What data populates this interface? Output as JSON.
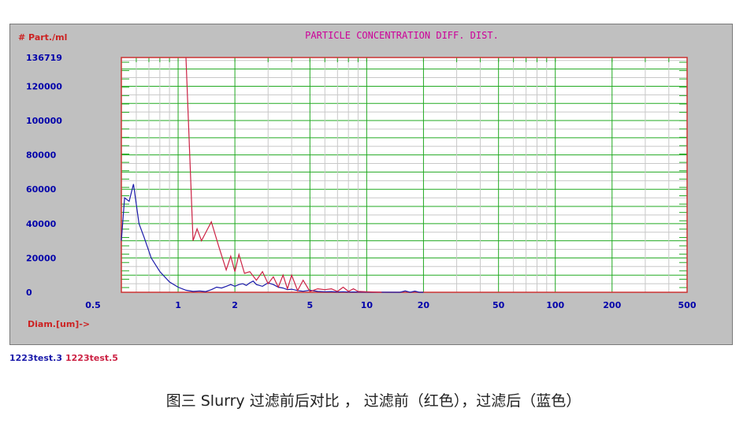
{
  "chart_data": {
    "type": "line",
    "title": "PARTICLE CONCENTRATION DIFF. DIST.",
    "ylabel": "# Part./ml",
    "xlabel": "Diam.[um]->",
    "x_scale": "log",
    "xlim": [
      0.5,
      500
    ],
    "ylim": [
      0,
      136719
    ],
    "y_ticks": [
      "0",
      "20000",
      "40000",
      "60000",
      "80000",
      "100000",
      "120000",
      "136719"
    ],
    "y_tick_values": [
      0,
      20000,
      40000,
      60000,
      80000,
      100000,
      120000,
      136719
    ],
    "x_ticks": [
      "0.5",
      "1",
      "2",
      "5",
      "10",
      "20",
      "50",
      "100",
      "200",
      "500"
    ],
    "x_tick_values": [
      0.5,
      1,
      2,
      5,
      10,
      20,
      50,
      100,
      200,
      500
    ],
    "grid": true,
    "series": [
      {
        "name": "1223test.3",
        "color": "#1a1aaa",
        "x": [
          0.5,
          0.52,
          0.55,
          0.58,
          0.62,
          0.66,
          0.72,
          0.8,
          0.9,
          1.0,
          1.1,
          1.2,
          1.3,
          1.4,
          1.5,
          1.6,
          1.7,
          1.8,
          1.9,
          2.0,
          2.1,
          2.2,
          2.3,
          2.4,
          2.5,
          2.6,
          2.8,
          3.0,
          3.2,
          3.4,
          3.6,
          3.8,
          4.0,
          4.3,
          4.6,
          5.0,
          5.5,
          6.0,
          6.5,
          7.0,
          7.5,
          8.0,
          8.5,
          10,
          15,
          16,
          17,
          18,
          19,
          20
        ],
        "values": [
          30000,
          55000,
          53000,
          63000,
          40000,
          32000,
          20000,
          12000,
          6000,
          3000,
          1200,
          500,
          800,
          400,
          1500,
          3000,
          2500,
          3500,
          4500,
          3500,
          4500,
          5000,
          4000,
          5500,
          6500,
          4500,
          3500,
          5500,
          4500,
          3000,
          2500,
          1500,
          1800,
          1000,
          600,
          1200,
          500,
          300,
          400,
          200,
          300,
          150,
          200,
          100,
          0,
          800,
          0,
          700,
          0,
          0
        ]
      },
      {
        "name": "1223test.5",
        "color": "#cc2244",
        "x": [
          1.1,
          1.2,
          1.26,
          1.33,
          1.42,
          1.5,
          1.65,
          1.8,
          1.9,
          2.0,
          2.1,
          2.25,
          2.4,
          2.6,
          2.8,
          3.0,
          3.2,
          3.4,
          3.6,
          3.8,
          4.0,
          4.3,
          4.6,
          5.0,
          5.5,
          6.0,
          6.5,
          7.0,
          7.5,
          8.0,
          8.5,
          9.0,
          10,
          12
        ],
        "values": [
          136719,
          30000,
          37000,
          30000,
          36000,
          41000,
          26000,
          13000,
          21000,
          12000,
          22000,
          11000,
          12000,
          7000,
          12000,
          5000,
          9000,
          3000,
          10000,
          2000,
          10000,
          1000,
          7000,
          500,
          2000,
          1500,
          2000,
          500,
          3000,
          500,
          2000,
          500,
          300,
          0
        ]
      }
    ]
  },
  "legend": {
    "entries": [
      {
        "label": "1223test.3",
        "color": "#1a1aaa"
      },
      {
        "label": "1223test.5",
        "color": "#cc2244"
      }
    ]
  },
  "caption": "图三 Slurry 过滤前后对比 ， 过滤前（红色），过滤后（蓝色）"
}
